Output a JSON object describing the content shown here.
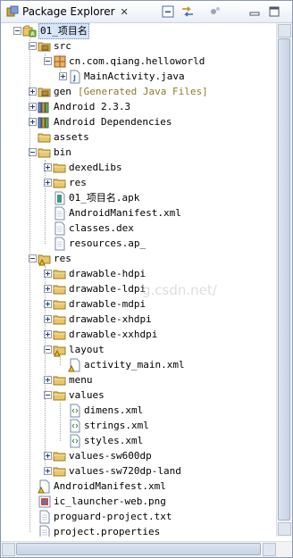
{
  "view": {
    "title": "Package Explorer",
    "close_glyph": "✕"
  },
  "toolbar": [
    {
      "name": "collapse-all-icon",
      "kind": "collapse"
    },
    {
      "name": "link-with-editor-icon",
      "kind": "link"
    },
    {
      "name": "view-menu-icon",
      "kind": "menu"
    },
    {
      "name": "minimize-icon",
      "kind": "min"
    },
    {
      "name": "maximize-icon",
      "kind": "max"
    }
  ],
  "tree": [
    {
      "label": "01_项目名",
      "icon": "project",
      "depth": 0,
      "exp": "open",
      "selected": true
    },
    {
      "label": "src",
      "icon": "srcfolder",
      "depth": 1,
      "exp": "open"
    },
    {
      "label": "cn.com.qiang.helloworld",
      "icon": "package",
      "depth": 2,
      "exp": "open"
    },
    {
      "label": "MainActivity.java",
      "icon": "java",
      "depth": 3,
      "exp": "closed"
    },
    {
      "label": "gen",
      "icon": "srcfolder",
      "depth": 1,
      "exp": "closed",
      "decoration": "[Generated Java Files]"
    },
    {
      "label": "Android 2.3.3",
      "icon": "library",
      "depth": 1,
      "exp": "closed"
    },
    {
      "label": "Android Dependencies",
      "icon": "library",
      "depth": 1,
      "exp": "closed"
    },
    {
      "label": "assets",
      "icon": "folder",
      "depth": 1,
      "exp": "none"
    },
    {
      "label": "bin",
      "icon": "folder",
      "depth": 1,
      "exp": "open"
    },
    {
      "label": "dexedLibs",
      "icon": "folder",
      "depth": 2,
      "exp": "closed"
    },
    {
      "label": "res",
      "icon": "folder",
      "depth": 2,
      "exp": "closed"
    },
    {
      "label": "01_项目名.apk",
      "icon": "apk",
      "depth": 2,
      "exp": "none"
    },
    {
      "label": "AndroidManifest.xml",
      "icon": "file",
      "depth": 2,
      "exp": "none"
    },
    {
      "label": "classes.dex",
      "icon": "file",
      "depth": 2,
      "exp": "none"
    },
    {
      "label": "resources.ap_",
      "icon": "file",
      "depth": 2,
      "exp": "none"
    },
    {
      "label": "res",
      "icon": "warnfolder",
      "depth": 1,
      "exp": "open"
    },
    {
      "label": "drawable-hdpi",
      "icon": "folder",
      "depth": 2,
      "exp": "closed"
    },
    {
      "label": "drawable-ldpi",
      "icon": "folder",
      "depth": 2,
      "exp": "closed"
    },
    {
      "label": "drawable-mdpi",
      "icon": "folder",
      "depth": 2,
      "exp": "closed"
    },
    {
      "label": "drawable-xhdpi",
      "icon": "folder",
      "depth": 2,
      "exp": "closed"
    },
    {
      "label": "drawable-xxhdpi",
      "icon": "folder",
      "depth": 2,
      "exp": "closed"
    },
    {
      "label": "layout",
      "icon": "warnfolder",
      "depth": 2,
      "exp": "open"
    },
    {
      "label": "activity_main.xml",
      "icon": "warnxml",
      "depth": 3,
      "exp": "none"
    },
    {
      "label": "menu",
      "icon": "folder",
      "depth": 2,
      "exp": "closed"
    },
    {
      "label": "values",
      "icon": "folder",
      "depth": 2,
      "exp": "open"
    },
    {
      "label": "dimens.xml",
      "icon": "xml",
      "depth": 3,
      "exp": "none"
    },
    {
      "label": "strings.xml",
      "icon": "xml",
      "depth": 3,
      "exp": "none"
    },
    {
      "label": "styles.xml",
      "icon": "xml",
      "depth": 3,
      "exp": "none"
    },
    {
      "label": "values-sw600dp",
      "icon": "folder",
      "depth": 2,
      "exp": "closed"
    },
    {
      "label": "values-sw720dp-land",
      "icon": "folder",
      "depth": 2,
      "exp": "closed"
    },
    {
      "label": "AndroidManifest.xml",
      "icon": "warnxml",
      "depth": 1,
      "exp": "none"
    },
    {
      "label": "ic_launcher-web.png",
      "icon": "image",
      "depth": 1,
      "exp": "none"
    },
    {
      "label": "proguard-project.txt",
      "icon": "file",
      "depth": 1,
      "exp": "none"
    },
    {
      "label": "project.properties",
      "icon": "file",
      "depth": 1,
      "exp": "none"
    }
  ],
  "watermark": "g.csdn.net/",
  "colors": {
    "selection": "#d7e5f8",
    "folder": "#e8c66a",
    "warning": "#f0c020",
    "accent": "#3d6bb5"
  }
}
